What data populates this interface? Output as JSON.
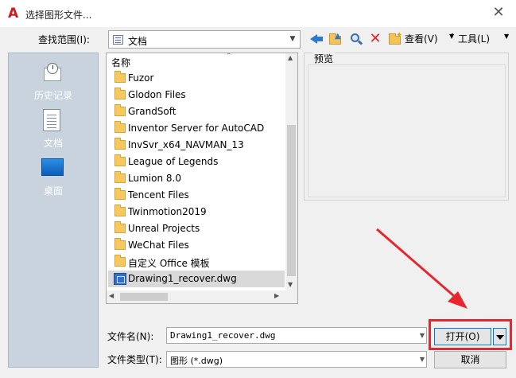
{
  "window": {
    "title": "选择图形文件..."
  },
  "toolbar": {
    "look_in_label": "查找范围(I):",
    "look_in_value": "文档",
    "views_label": "查看(V)",
    "tools_label": "工具(L)"
  },
  "places": [
    {
      "label": "历史记录"
    },
    {
      "label": "文档"
    },
    {
      "label": "桌面"
    }
  ],
  "file_list": {
    "column_header": "名称",
    "items": [
      {
        "name": "Fuzor",
        "type": "folder"
      },
      {
        "name": "Glodon Files",
        "type": "folder"
      },
      {
        "name": "GrandSoft",
        "type": "folder"
      },
      {
        "name": "Inventor Server for AutoCAD",
        "type": "folder"
      },
      {
        "name": "InvSvr_x64_NAVMAN_13",
        "type": "folder"
      },
      {
        "name": "League of Legends",
        "type": "folder"
      },
      {
        "name": "Lumion 8.0",
        "type": "folder"
      },
      {
        "name": "Tencent Files",
        "type": "folder"
      },
      {
        "name": "Twinmotion2019",
        "type": "folder"
      },
      {
        "name": "Unreal Projects",
        "type": "folder"
      },
      {
        "name": "WeChat Files",
        "type": "folder"
      },
      {
        "name": "自定义 Office 模板",
        "type": "folder"
      },
      {
        "name": "Drawing1_recover.dwg",
        "type": "dwg",
        "selected": true
      }
    ]
  },
  "preview": {
    "label": "预览"
  },
  "form": {
    "filename_label": "文件名(N):",
    "filename_value": "Drawing1_recover.dwg",
    "filetype_label": "文件类型(T):",
    "filetype_value": "图形 (*.dwg)"
  },
  "buttons": {
    "open_label": "打开(O)",
    "cancel_label": "取消"
  },
  "colors": {
    "annotation_red": "#e8262e",
    "selection_gray": "#d9d9d9",
    "places_bg": "#c8d3de",
    "accent_blue": "#0078d7"
  }
}
